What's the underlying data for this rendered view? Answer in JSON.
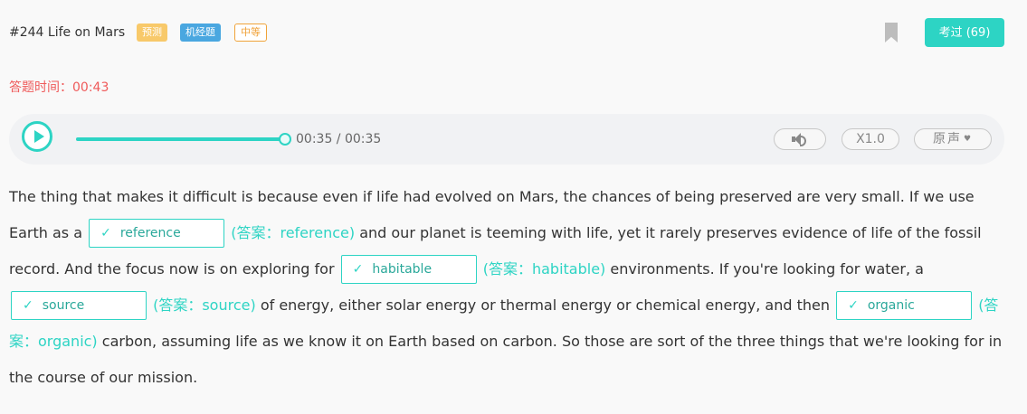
{
  "header": {
    "title": "#244 Life on Mars",
    "tags": [
      "预测",
      "机经题",
      "中等"
    ],
    "bookmark_icon": "bookmark-icon",
    "exam_button": "考过 (69)"
  },
  "timer": "答题时间：00:43",
  "player": {
    "time_display": "00:35 / 00:35",
    "progress": 1.0,
    "speed": "X1.0",
    "voice": "原声",
    "volume_icon": "speaker-icon",
    "play_icon": "play-icon"
  },
  "passage": {
    "check_mark": "✓",
    "p1": "The thing that makes it difficult is because even if life had evolved on Mars, the chances of being preserved are very small. If we use Earth as a",
    "p2": "and our planet is teeming with life, yet it rarely preserves evidence of life of the fossil record. And the focus now is on exploring for",
    "p3": "environments. If you're looking for water, a",
    "p4": "of energy, either solar energy or thermal energy or chemical energy, and then",
    "p5": "carbon, assuming life as we know it on Earth based on carbon. So those are sort of the three things that we're looking for in the course of our mission.",
    "blanks": [
      {
        "value": "reference",
        "answer": "(答案：reference)"
      },
      {
        "value": "habitable",
        "answer": "(答案：habitable)"
      },
      {
        "value": "source",
        "answer": "(答案：source)"
      },
      {
        "value": "organic",
        "answer": "(答案：organic)"
      }
    ]
  },
  "colors": {
    "accent": "#2dd4c4",
    "timer": "#ef5a5a",
    "tag_predict": "#f8c96a",
    "tag_jijing": "#4aa7e0",
    "tag_medium": "#f0a33a"
  }
}
